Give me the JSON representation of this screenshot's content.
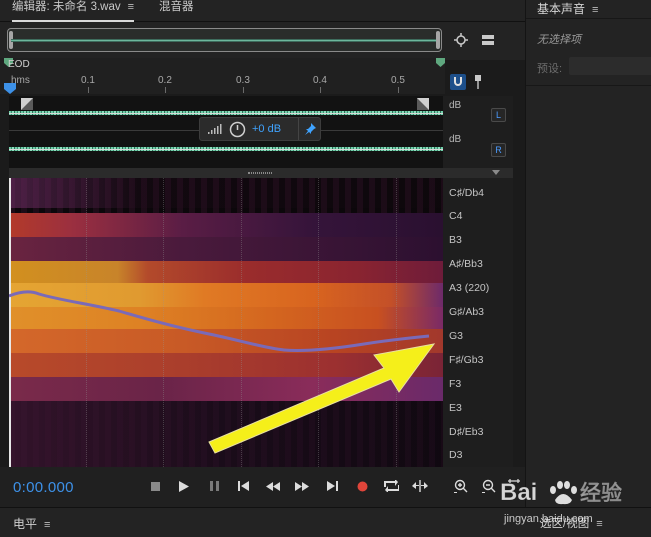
{
  "tabs": {
    "editor_label": "编辑器: 未命名 3.wav",
    "mixer_label": "混音器",
    "menu_glyph": "≡"
  },
  "timeline": {
    "eod_label": "EOD",
    "ticks": [
      "hms",
      "0.1",
      "0.2",
      "0.3",
      "0.4",
      "0.5"
    ]
  },
  "waveform": {
    "db_label_top": "dB",
    "db_label_bottom": "dB",
    "left_channel": "L",
    "right_channel": "R",
    "gain_value": "+0 dB"
  },
  "pitch_labels": [
    "C♯/Db4",
    "C4",
    "B3",
    "A♯/Bb3",
    "A3 (220)",
    "G♯/Ab3",
    "G3",
    "F♯/Gb3",
    "F3",
    "E3",
    "D♯/Eb3",
    "D3"
  ],
  "transport": {
    "timecode": "0:00.000"
  },
  "bottom": {
    "levels_label": "电平",
    "selection_label": "选区/视图",
    "menu_glyph": "≡"
  },
  "right_panel": {
    "title": "基本声音",
    "menu_glyph": "≡",
    "no_selection": "无选择项",
    "preset_label": "预设:"
  },
  "watermark": {
    "brand": "Bai",
    "brand_suffix": "经验",
    "url": "jingyan.baidu.com"
  },
  "colors": {
    "accent": "#3d91e8",
    "waveform": "#6fcea9",
    "record": "#e0453a",
    "arrow": "#f5ef1a"
  }
}
